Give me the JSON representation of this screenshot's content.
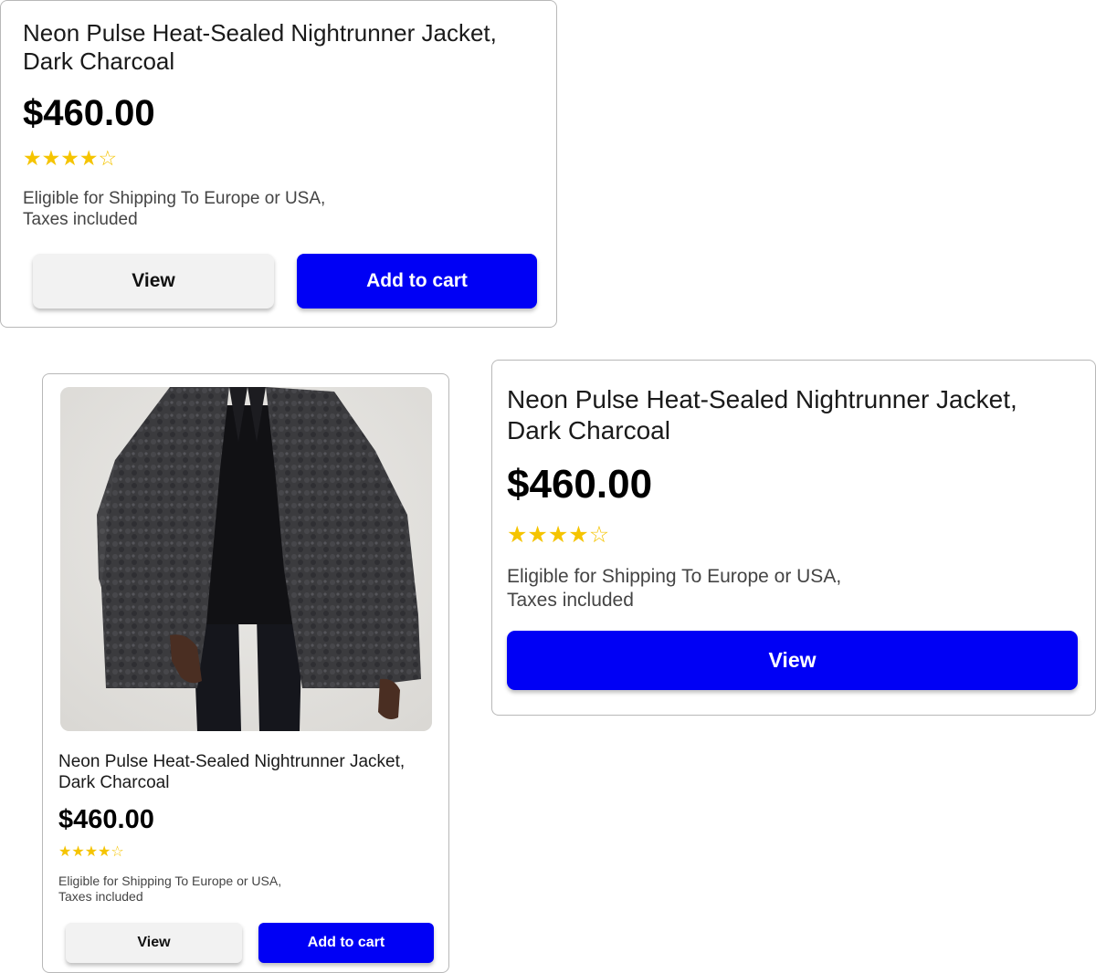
{
  "colors": {
    "primary_button": "#0000f5",
    "secondary_button": "#f2f2f2",
    "star": "#f5c400",
    "border": "#b8b8b8"
  },
  "cards": [
    {
      "title": "Neon Pulse Heat-Sealed Nightrunner Jacket, Dark Charcoal",
      "price": "$460.00",
      "rating": 4,
      "rating_max": 5,
      "stars": [
        "★",
        "★",
        "★",
        "★",
        "☆"
      ],
      "shipping_line1": "Eligible for Shipping To Europe or USA,",
      "shipping_line2": "Taxes included",
      "view_label": "View",
      "cart_label": "Add to cart"
    },
    {
      "image_icon": "product-photo",
      "title": "Neon Pulse Heat-Sealed Nightrunner Jacket, Dark Charcoal",
      "price": "$460.00",
      "rating": 4,
      "rating_max": 5,
      "stars": [
        "★",
        "★",
        "★",
        "★",
        "☆"
      ],
      "shipping_line1": "Eligible for Shipping To Europe or USA,",
      "shipping_line2": "Taxes included",
      "view_label": "View",
      "cart_label": "Add to cart"
    },
    {
      "title": "Neon Pulse Heat-Sealed Nightrunner Jacket, Dark Charcoal",
      "price": "$460.00",
      "rating": 4,
      "rating_max": 5,
      "stars": [
        "★",
        "★",
        "★",
        "★",
        "☆"
      ],
      "shipping_line1": "Eligible for Shipping To Europe or USA,",
      "shipping_line2": "Taxes included",
      "view_label": "View"
    }
  ]
}
